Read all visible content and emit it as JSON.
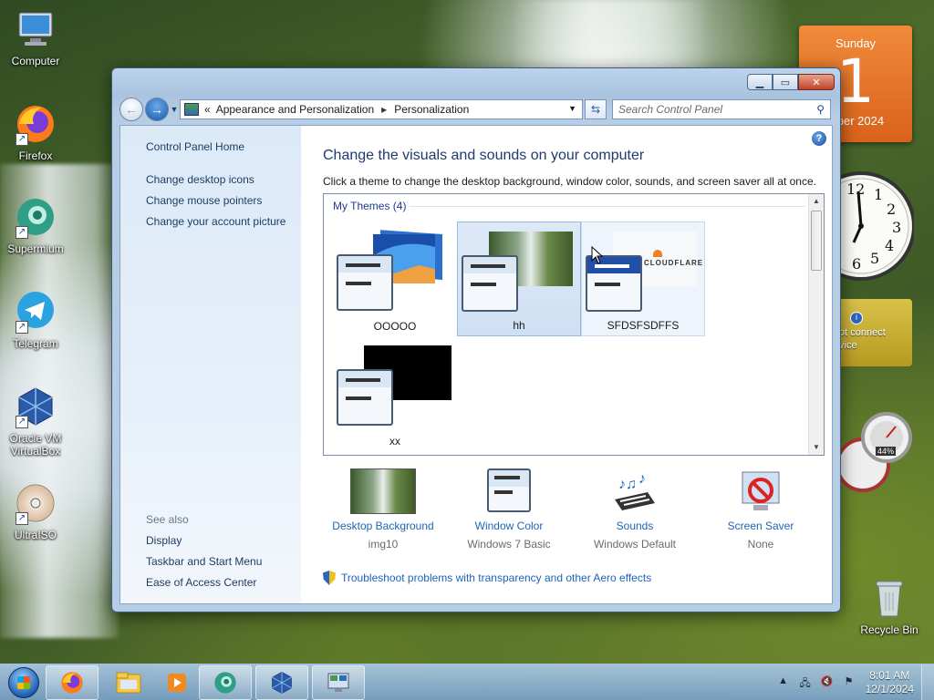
{
  "desktop": {
    "icons": [
      {
        "label": "Computer"
      },
      {
        "label": "Firefox"
      },
      {
        "label": "Supermium"
      },
      {
        "label": "Telegram"
      },
      {
        "label": "Oracle VM VirtualBox"
      },
      {
        "label": "UltraISO"
      },
      {
        "label": "Recycle Bin"
      }
    ]
  },
  "gadgets": {
    "calendar": {
      "weekday": "Sunday",
      "day": "1",
      "month": "mber 2024"
    },
    "clock": {
      "numerals": [
        "12",
        "1",
        "2",
        "3",
        "4",
        "5",
        "6"
      ]
    },
    "weather": {
      "text": "ot connect\nvice"
    },
    "meter": {
      "cpu": "44%"
    }
  },
  "window": {
    "address": {
      "overflow": "«",
      "crumb1": "Appearance and Personalization",
      "sep": "▸",
      "crumb2": "Personalization"
    },
    "search": {
      "placeholder": "Search Control Panel"
    },
    "leftnav": {
      "home": "Control Panel Home",
      "links": [
        "Change desktop icons",
        "Change mouse pointers",
        "Change your account picture"
      ],
      "see_also": "See also",
      "see_also_links": [
        "Display",
        "Taskbar and Start Menu",
        "Ease of Access Center"
      ]
    },
    "heading": "Change the visuals and sounds on your computer",
    "subtext": "Click a theme to change the desktop background, window color, sounds, and screen saver all at once.",
    "themes": {
      "group": "My Themes (4)",
      "items": [
        {
          "name": "OOOOO",
          "selected": false
        },
        {
          "name": "hh",
          "selected": true
        },
        {
          "name": "SFDSFSDFFS",
          "selected": false,
          "brand": "CLOUDFLARE"
        },
        {
          "name": "xx",
          "selected": false
        }
      ]
    },
    "bottom": [
      {
        "link": "Desktop Background",
        "value": "img10"
      },
      {
        "link": "Window Color",
        "value": "Windows 7 Basic"
      },
      {
        "link": "Sounds",
        "value": "Windows Default"
      },
      {
        "link": "Screen Saver",
        "value": "None"
      }
    ],
    "troubleshoot": "Troubleshoot problems with transparency and other Aero effects"
  },
  "taskbar": {
    "time": "8:01 AM",
    "date": "12/1/2024"
  },
  "colors": {
    "link": "#1e63b8",
    "heading": "#1e3a6e",
    "calendar": "#e8762a",
    "selection": "#cfe0f4"
  }
}
